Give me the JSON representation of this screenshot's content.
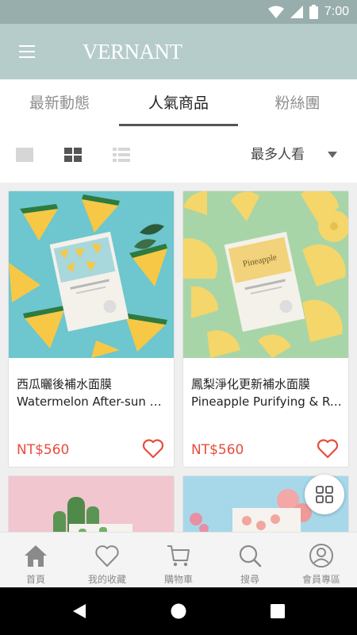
{
  "status_bar": {
    "time": "7:00",
    "icons": [
      "wifi-icon",
      "cell-signal-icon",
      "battery-icon"
    ],
    "background": "#98aeac"
  },
  "app_bar": {
    "menu_icon": "hamburger-menu-icon",
    "logo": "VERNANT",
    "background": "#b5cccb"
  },
  "tabs": [
    {
      "label": "最新動態",
      "active": false
    },
    {
      "label": "人氣商品",
      "active": true
    },
    {
      "label": "粉絲團",
      "active": false
    }
  ],
  "toolbar": {
    "view_modes": [
      "single-view-icon",
      "grid-view-icon",
      "list-view-icon"
    ],
    "active_view": "grid-view-icon",
    "sort_label": "最多人看",
    "sort_icon": "caret-down-icon"
  },
  "products": [
    {
      "name_zh": "西瓜曬後補水面膜",
      "name_en": "Watermelon After-sun M...",
      "price": "NT$560",
      "image": "watermelon-mask-photo",
      "favorite_icon": "heart-outline-icon"
    },
    {
      "name_zh": "鳳梨淨化更新補水面膜",
      "name_en": "Pineapple Purifying & Re...",
      "price": "NT$560",
      "image": "pineapple-mask-photo",
      "favorite_icon": "heart-outline-icon"
    },
    {
      "image": "cactus-mask-photo"
    },
    {
      "image": "peach-rose-mask-photo"
    }
  ],
  "fab": {
    "icon": "category-grid-icon"
  },
  "bottom_nav": [
    {
      "label": "首頁",
      "icon": "home-icon"
    },
    {
      "label": "我的收藏",
      "icon": "heart-icon"
    },
    {
      "label": "購物車",
      "icon": "cart-icon"
    },
    {
      "label": "搜尋",
      "icon": "search-icon"
    },
    {
      "label": "會員專區",
      "icon": "user-icon"
    }
  ],
  "colors": {
    "accent_price": "#e84c3d",
    "tab_active_underline": "#555555"
  },
  "system_nav": [
    "back-icon",
    "home-circle-icon",
    "recents-icon"
  ]
}
